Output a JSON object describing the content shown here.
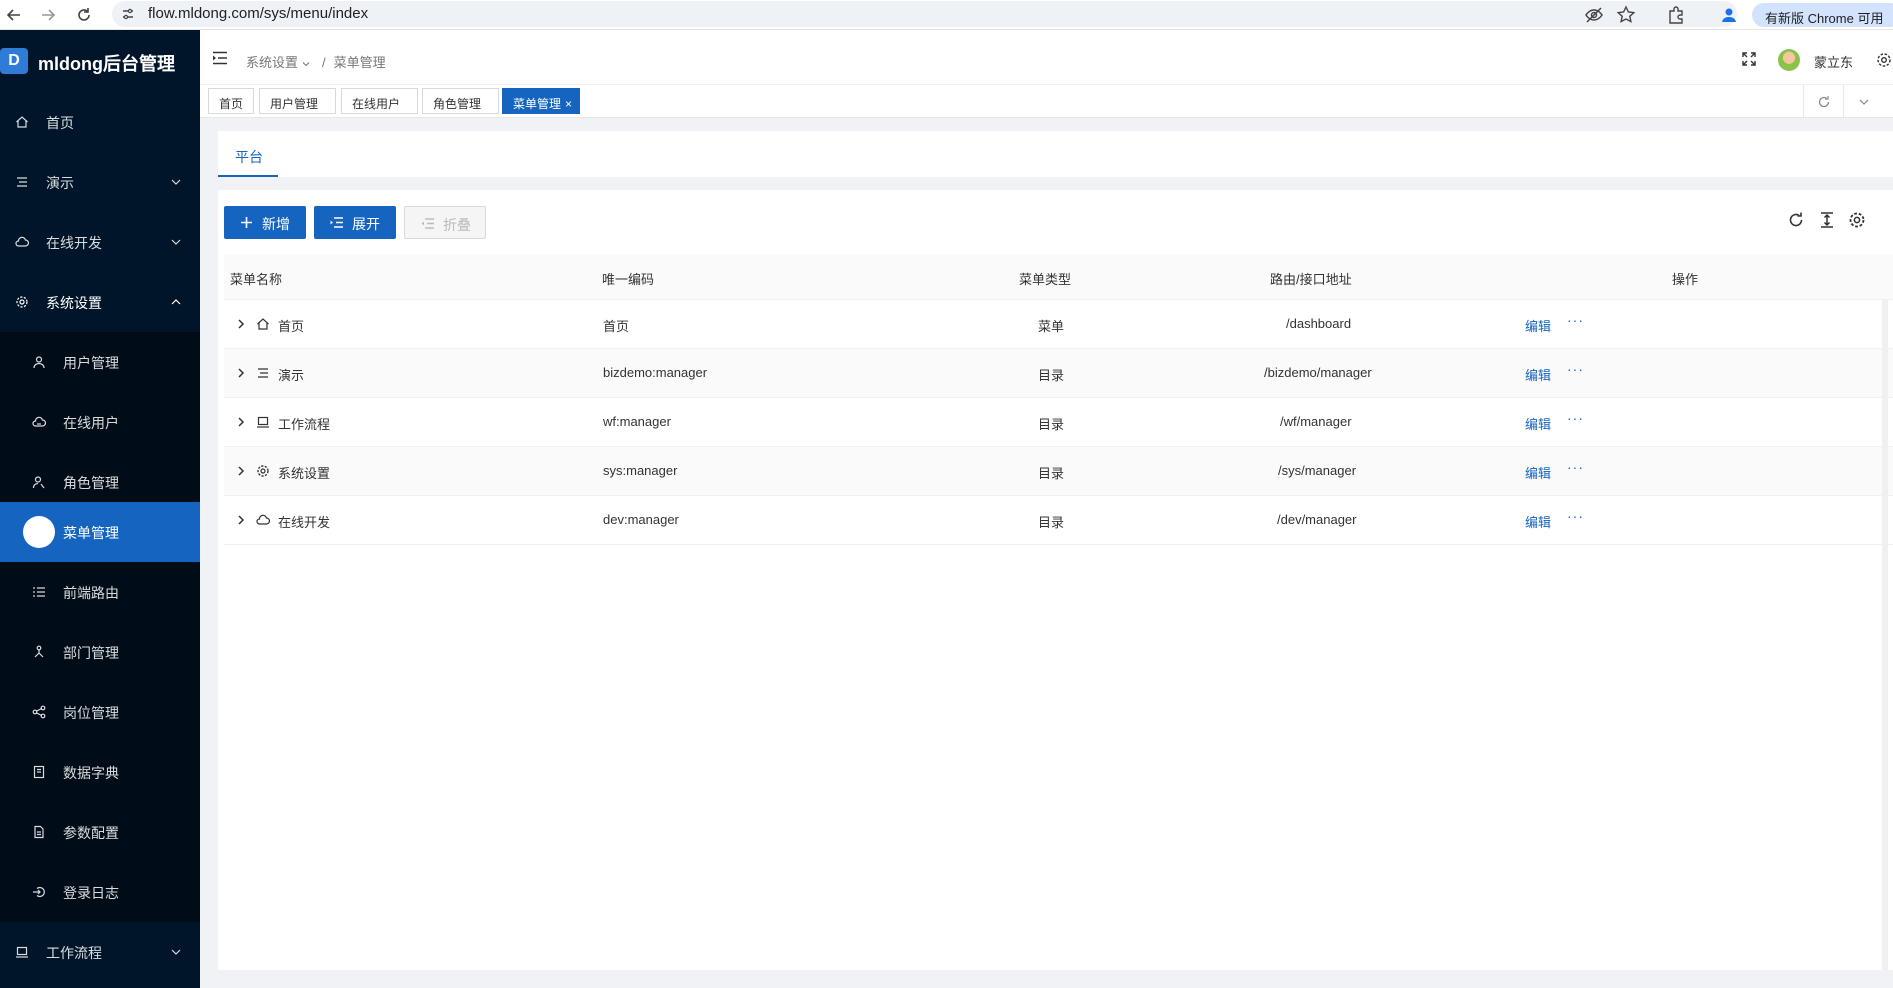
{
  "browser": {
    "url": "flow.mldong.com/sys/menu/index",
    "update_pill": "有新版 Chrome 可用"
  },
  "sidebar": {
    "logo_mark": "D",
    "logo_text": "mldong后台管理",
    "items": [
      {
        "label": "首页",
        "icon": "home-icon"
      },
      {
        "label": "演示",
        "icon": "list-icon"
      },
      {
        "label": "在线开发",
        "icon": "cloud-icon"
      },
      {
        "label": "系统设置",
        "icon": "gear-icon"
      }
    ],
    "sub_items": [
      {
        "label": "用户管理",
        "icon": "user-icon"
      },
      {
        "label": "在线用户",
        "icon": "online-icon"
      },
      {
        "label": "角色管理",
        "icon": "role-icon"
      },
      {
        "label": "菜单管理",
        "icon": "menu-icon"
      },
      {
        "label": "前端路由",
        "icon": "route-icon"
      },
      {
        "label": "部门管理",
        "icon": "dept-icon"
      },
      {
        "label": "岗位管理",
        "icon": "share-icon"
      },
      {
        "label": "数据字典",
        "icon": "book-icon"
      },
      {
        "label": "参数配置",
        "icon": "file-icon"
      },
      {
        "label": "登录日志",
        "icon": "login-icon"
      }
    ],
    "bottom_item": {
      "label": "工作流程",
      "icon": "laptop-icon"
    }
  },
  "header": {
    "breadcrumb_parent": "系统设置",
    "breadcrumb_sep": "/",
    "breadcrumb_current": "菜单管理",
    "user_name": "蒙立东"
  },
  "tabs": [
    {
      "label": "首页"
    },
    {
      "label": "用户管理"
    },
    {
      "label": "在线用户"
    },
    {
      "label": "角色管理"
    },
    {
      "label": "菜单管理",
      "close": "×"
    }
  ],
  "content": {
    "platform_tab": "平台",
    "btn_add": "新增",
    "btn_expand": "展开",
    "btn_collapse": "折叠",
    "columns": [
      "菜单名称",
      "唯一编码",
      "菜单类型",
      "路由/接口地址",
      "操作"
    ],
    "edit_label": "编辑",
    "more_label": "···",
    "rows": [
      {
        "name": "首页",
        "code": "首页",
        "type": "菜单",
        "path": "/dashboard",
        "icon": "home-icon"
      },
      {
        "name": "演示",
        "code": "bizdemo:manager",
        "type": "目录",
        "path": "/bizdemo/manager",
        "icon": "list-icon"
      },
      {
        "name": "工作流程",
        "code": "wf:manager",
        "type": "目录",
        "path": "/wf/manager",
        "icon": "laptop-icon"
      },
      {
        "name": "系统设置",
        "code": "sys:manager",
        "type": "目录",
        "path": "/sys/manager",
        "icon": "gear-icon"
      },
      {
        "name": "在线开发",
        "code": "dev:manager",
        "type": "目录",
        "path": "/dev/manager",
        "icon": "cloud-icon"
      }
    ]
  },
  "colors": {
    "sidebar_bg": "#001529",
    "submenu_bg": "#000c17",
    "accent": "#1565c0"
  }
}
